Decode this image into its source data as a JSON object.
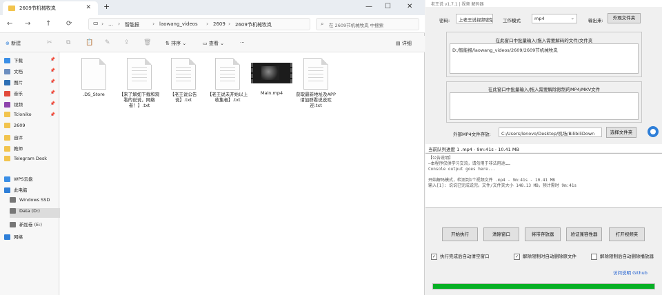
{
  "explorer": {
    "tab_title": "2609节机械牧岚",
    "new_tab": "+",
    "window_controls": [
      "—",
      "☐",
      "✕"
    ],
    "nav": [
      "←",
      "→",
      "↑",
      "⟳"
    ],
    "breadcrumb": [
      "…",
      "智能报",
      "laowang_videos",
      "2609",
      "2609节机械牧岚"
    ],
    "search_placeholder": "在 2609节机械牧岚 中搜索",
    "toolbar": {
      "new": "新建",
      "sort": "排序",
      "view": "查看",
      "more": "···",
      "details": "详细"
    },
    "sidebar": [
      {
        "label": "下载",
        "color": "#3a8ee6",
        "pin": true
      },
      {
        "label": "文档",
        "color": "#6c8ebf",
        "pin": true
      },
      {
        "label": "图片",
        "color": "#2c6fb5",
        "pin": true
      },
      {
        "label": "音乐",
        "color": "#e24a3b",
        "pin": true
      },
      {
        "label": "视频",
        "color": "#8e44ad",
        "pin": true
      },
      {
        "label": "Tcloniko",
        "color": "#f2c44e",
        "pin": true
      },
      {
        "label": "2609",
        "color": "#f2c44e",
        "pin": false
      },
      {
        "label": "自评",
        "color": "#f2c44e",
        "pin": false
      },
      {
        "label": "教师",
        "color": "#f2c44e",
        "pin": false
      },
      {
        "label": "Telegram Desk",
        "color": "#f2c44e",
        "pin": false
      },
      {
        "label": "WPS云盘",
        "color": "#3a8ee6",
        "pin": false
      },
      {
        "label": "此电脑",
        "color": "#2f7fd8",
        "pin": false
      },
      {
        "label": "Windows SSD",
        "color": "#777777",
        "pin": false
      },
      {
        "label": "Data (D:)",
        "color": "#777777",
        "pin": false
      },
      {
        "label": "新加卷 (E:)",
        "color": "#777777",
        "pin": false
      },
      {
        "label": "网络",
        "color": "#2f7fd8",
        "pin": false
      }
    ],
    "files": [
      {
        "name": ".DS_Store",
        "kind": "blank"
      },
      {
        "name": "【来了解如下载和观看的说说，网络者！】.txt",
        "kind": "doc"
      },
      {
        "name": "【老王说公告说】.txt",
        "kind": "doc"
      },
      {
        "name": "【老王说未开始以上收集者】.txt",
        "kind": "doc"
      },
      {
        "name": "Main.mp4",
        "kind": "video"
      },
      {
        "name": "获取最新地址及APP请加群看说说欢迎.txt",
        "kind": "doc"
      }
    ]
  },
  "tool": {
    "title": "老王说 v1.7.1 | 视频 解码器",
    "encode_label": "密码:",
    "encode_value": "上老王说视频密钥",
    "mode_label": "工作模式",
    "mode_value": "mp4",
    "output_label": "输出来:",
    "output_btn": "外观文件夹",
    "panel1_title": "在此窗口中批量输入/拖入需要解码的文件/文件夹",
    "panel1_value": "D:/智能报/laowang_videos/2609/2609节机械牧岚",
    "panel2_title": "在此窗口中批量输入/拖入需要解除限制的MP4/MKV文件",
    "panel2_value": "",
    "outdir_label": "外部MP4文件存放:",
    "outdir_value": "C:/Users/lenovo/Desktop/机场/BilibiliDown",
    "choose_btn": "选择文件夹",
    "status_line": "当前队列进度 1 .mp4 - 9m:41s - 10.41 MB",
    "console": [
      "【公告说明】",
      "—本程序仅供学习交流，请勿用于非法用途……",
      "Console output goes here...",
      "",
      "开始解码模式，检测到1个视频文件 .mp4 - 9m:41s - 10.41 MB",
      "输入[1]: 说说已完成说完。文件/文件夹大小 148.13 MB，预计需时 9m:41s"
    ],
    "buttons": [
      "开始执行",
      "清除窗口",
      "将带存放器",
      "验证兼容性器",
      "打开视频夹"
    ],
    "checks": [
      {
        "label": "执行完成后自动清空窗口",
        "checked": true
      },
      {
        "label": "解除限制时自动删除原文件",
        "checked": true
      },
      {
        "label": "解除限制后自动删除播放器",
        "checked": false
      }
    ],
    "links": "访问说明 Github",
    "progress": 1.0
  }
}
